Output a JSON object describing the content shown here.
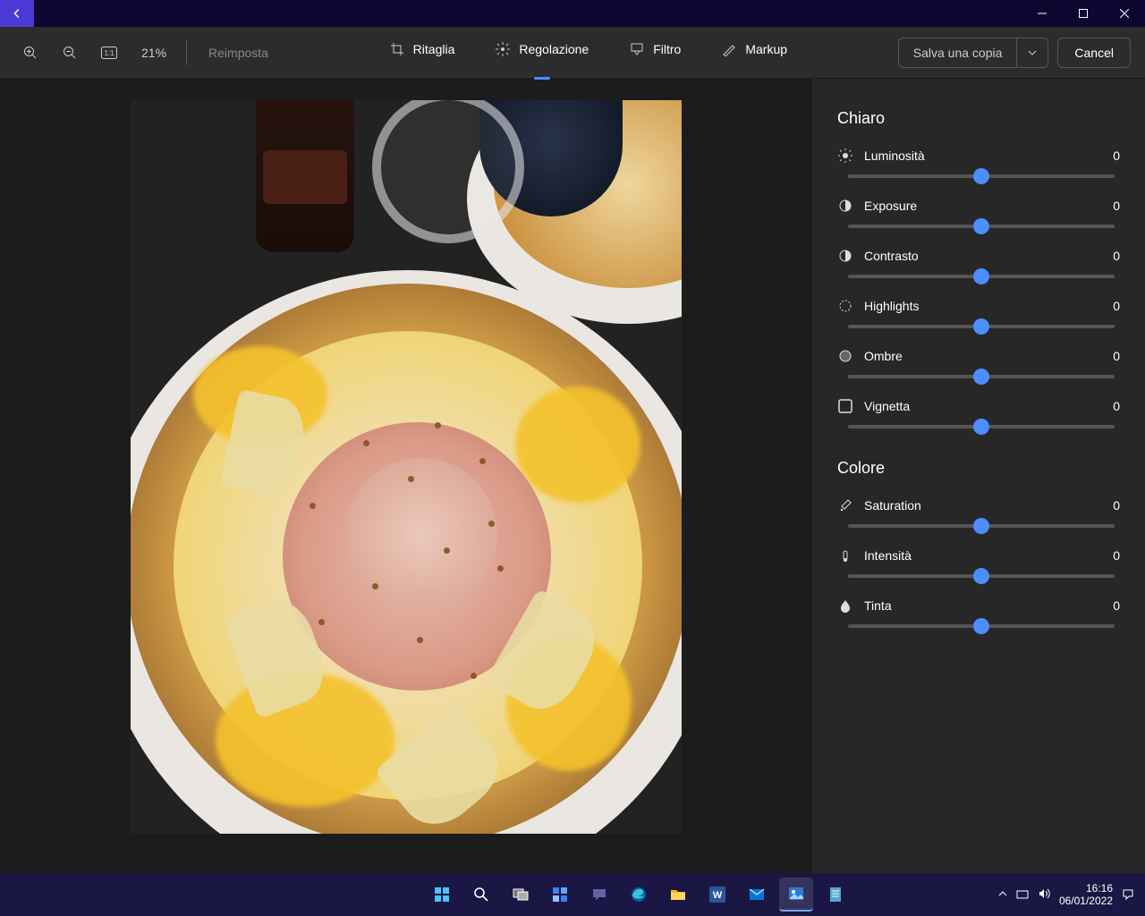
{
  "titlebar": {
    "back_icon": "←"
  },
  "toolbar": {
    "zoom_pct": "21%",
    "reset": "Reimposta",
    "tabs": [
      {
        "label": "Ritaglia"
      },
      {
        "label": "Regolazione"
      },
      {
        "label": "Filtro"
      },
      {
        "label": "Markup"
      }
    ],
    "save": "Salva una copia",
    "cancel": "Cancel"
  },
  "panel": {
    "section_light": "Chiaro",
    "section_color": "Colore",
    "sliders_light": [
      {
        "label": "Luminosità",
        "value": "0"
      },
      {
        "label": "Exposure",
        "value": "0"
      },
      {
        "label": "Contrasto",
        "value": "0"
      },
      {
        "label": "Highlights",
        "value": "0"
      },
      {
        "label": "Ombre",
        "value": "0"
      },
      {
        "label": "Vignetta",
        "value": "0"
      }
    ],
    "sliders_color": [
      {
        "label": "Saturation",
        "value": "0"
      },
      {
        "label": "Intensità",
        "value": "0"
      },
      {
        "label": "Tinta",
        "value": "0"
      }
    ]
  },
  "taskbar": {
    "time": "16:16",
    "date": "06/01/2022"
  }
}
